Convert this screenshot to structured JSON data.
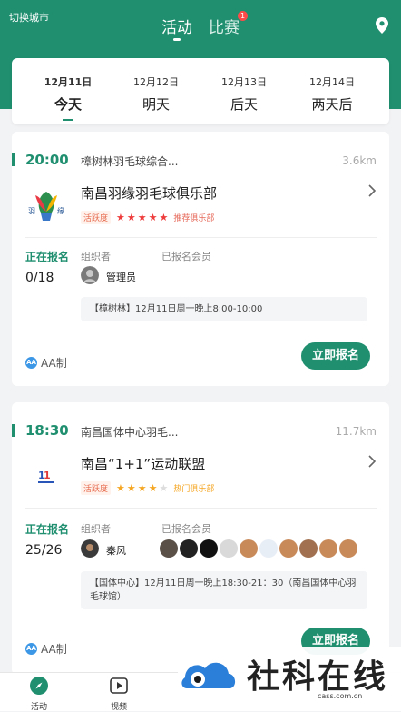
{
  "header": {
    "city_switch": "切换城市",
    "tabs": [
      {
        "label": "活动",
        "active": true
      },
      {
        "label": "比赛",
        "badge": "1"
      }
    ]
  },
  "dates": [
    {
      "date": "12月11日",
      "name": "今天",
      "active": true
    },
    {
      "date": "12月12日",
      "name": "明天"
    },
    {
      "date": "12月13日",
      "name": "后天"
    },
    {
      "date": "12月14日",
      "name": "两天后"
    }
  ],
  "events": [
    {
      "time": "20:00",
      "venue": "樟树林羽毛球综合...",
      "distance": "3.6km",
      "club": "南昌羽缘羽毛球俱乐部",
      "activity_tag": "活跃度",
      "stars": 5,
      "star_color": "#ee3b3b",
      "club_tag": "推荐俱乐部",
      "signup_label": "正在报名",
      "signup_count": "0/18",
      "organizer_label": "组织者",
      "organizer": "管理员",
      "members_label": "已报名会员",
      "note": "【樟树林】12月11日周一晚上8:00-10:00",
      "payment": "AA制",
      "aa_icon": "AA",
      "button": "立即报名"
    },
    {
      "time": "18:30",
      "venue": "南昌国体中心羽毛...",
      "distance": "11.7km",
      "club": "南昌“1+1”运动联盟",
      "activity_tag": "活跃度",
      "stars": 4,
      "star_color": "#f5a623",
      "club_tag": "热门俱乐部",
      "signup_label": "正在报名",
      "signup_count": "25/26",
      "organizer_label": "组织者",
      "organizer": "秦风",
      "members_label": "已报名会员",
      "note": "【国体中心】12月11日周一晚上18:30-21：30（南昌国体中心羽毛球馆）",
      "payment": "AA制",
      "aa_icon": "AA",
      "button": "立即报名"
    }
  ],
  "bottom_nav": [
    {
      "label": "活动",
      "icon": "compass-icon"
    },
    {
      "label": "视频",
      "icon": "play-icon"
    }
  ],
  "watermark": {
    "text": "社科在线",
    "url": "cass.com.cn"
  },
  "colors": {
    "primary": "#1f8f6f"
  }
}
